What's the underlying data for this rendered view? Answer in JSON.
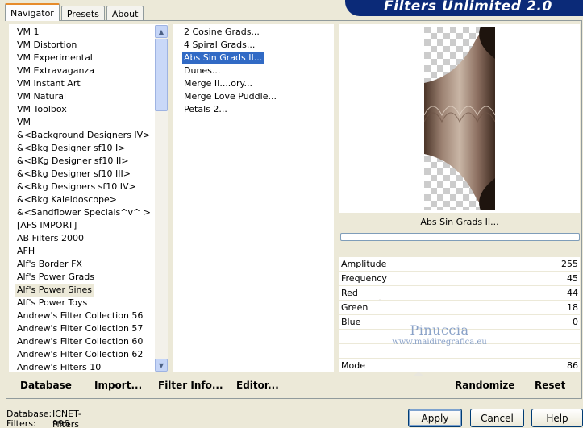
{
  "banner": {
    "title": "Filters Unlimited 2.0"
  },
  "tabs": [
    {
      "label": "Navigator"
    },
    {
      "label": "Presets"
    },
    {
      "label": "About"
    }
  ],
  "categories": [
    "VM 1",
    "VM Distortion",
    "VM Experimental",
    "VM Extravaganza",
    "VM Instant Art",
    "VM Natural",
    "VM Toolbox",
    "VM",
    "&<Background Designers IV>",
    "&<Bkg Designer sf10 I>",
    "&<BKg Designer sf10 II>",
    "&<Bkg Designer sf10 III>",
    "&<Bkg Designers sf10 IV>",
    "&<Bkg Kaleidoscope>",
    "&<Sandflower Specials^v^ >",
    "[AFS IMPORT]",
    "AB Filters 2000",
    "AFH",
    "Alf's Border FX",
    "Alf's Power Grads",
    "Alf's Power Sines",
    "Alf's Power Toys",
    "Andrew's Filter Collection 56",
    "Andrew's Filter Collection 57",
    "Andrew's Filter Collection 60",
    "Andrew's Filter Collection 62",
    "Andrew's Filters 10"
  ],
  "selected_category": "Alf's Power Sines",
  "filters": [
    "2 Cosine Grads...",
    "4 Spiral Grads...",
    "Abs Sin Grads II...",
    "Dunes...",
    "Merge II....ory...",
    "Merge Love Puddle...",
    "Petals 2..."
  ],
  "selected_filter": "Abs Sin Grads II...",
  "preview": {
    "filter_name": "Abs Sin Grads II..."
  },
  "parameters": [
    {
      "label": "Amplitude",
      "value": "255"
    },
    {
      "label": "Frequency",
      "value": "45"
    },
    {
      "label": "Red",
      "value": "44"
    },
    {
      "label": "Green",
      "value": "18"
    },
    {
      "label": "Blue",
      "value": "0"
    },
    {
      "label": "Mode",
      "value": "86"
    }
  ],
  "watermark": {
    "line1": "Pinuccia",
    "line2": "www.maidiregrafica.eu"
  },
  "toolbar": {
    "database": "Database",
    "import": "Import...",
    "filter_info": "Filter Info...",
    "editor": "Editor...",
    "randomize": "Randomize",
    "reset": "Reset"
  },
  "status": {
    "database_label": "Database:",
    "database_value": "ICNET-Filters",
    "filters_label": "Filters:",
    "filters_value": "996"
  },
  "buttons": {
    "apply": "Apply",
    "cancel": "Cancel",
    "help": "Help"
  }
}
